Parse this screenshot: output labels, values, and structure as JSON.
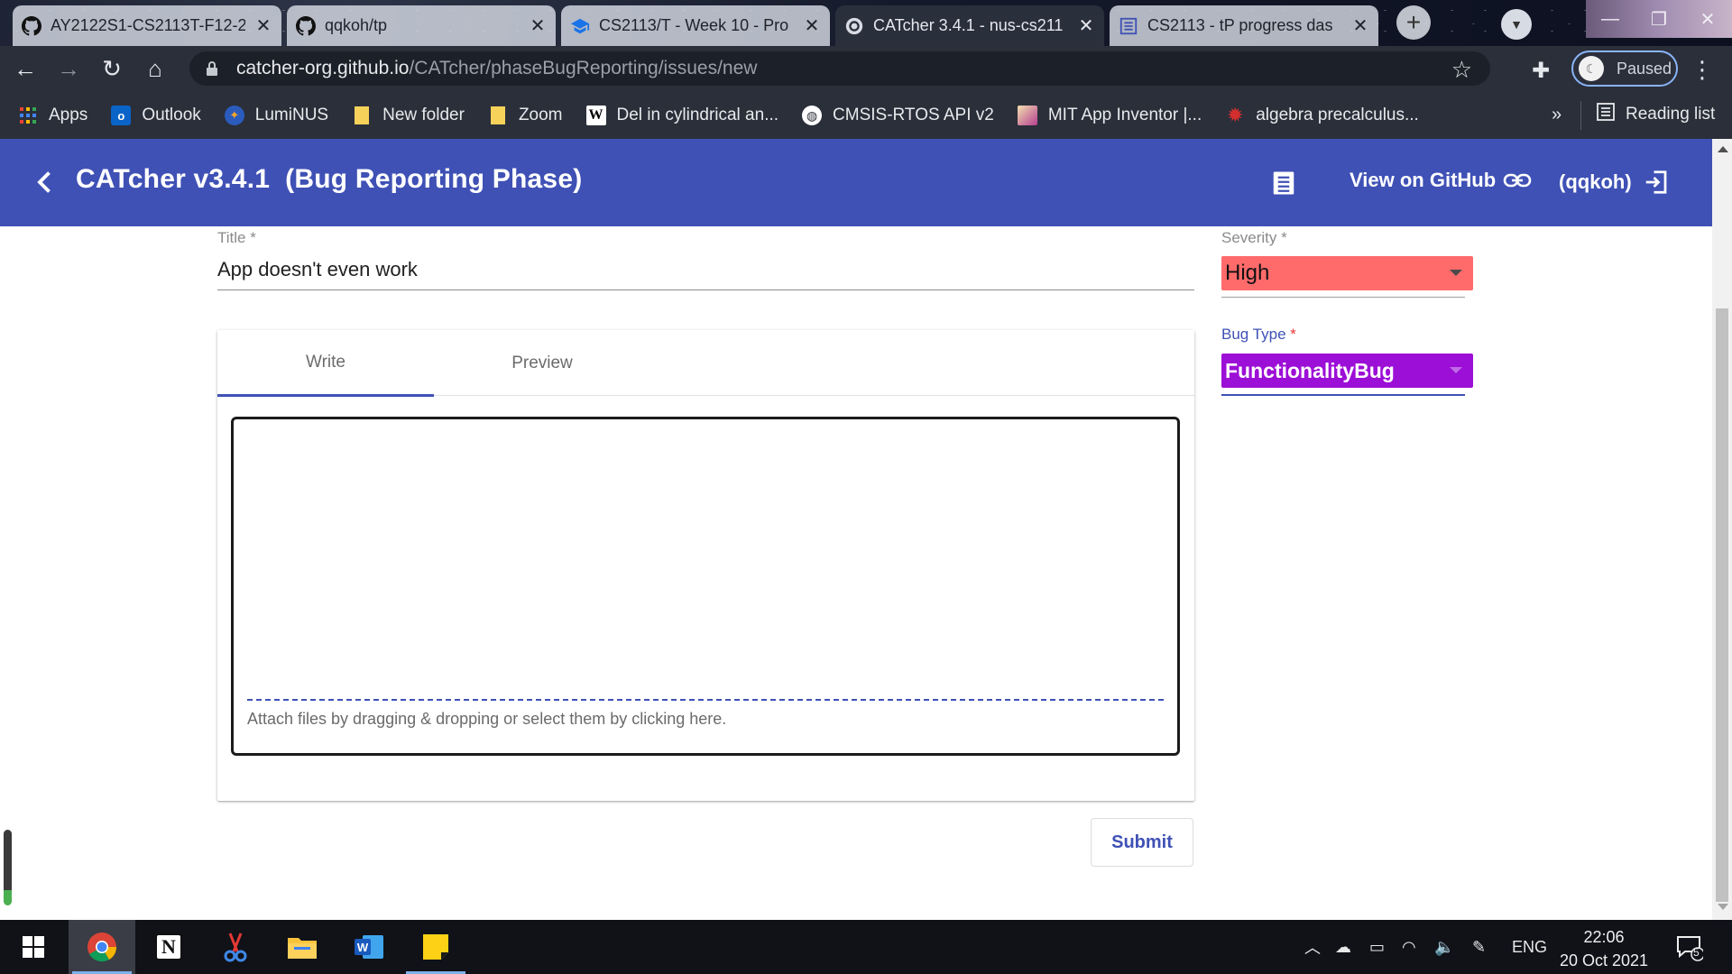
{
  "browser": {
    "tabs": [
      {
        "title": "AY2122S1-CS2113T-F12-2",
        "icon": "github-icon"
      },
      {
        "title": "qqkoh/tp",
        "icon": "github-icon"
      },
      {
        "title": "CS2113/T - Week 10 - Pro",
        "icon": "graduation-cap-icon"
      },
      {
        "title": "CATcher 3.4.1 - nus-cs211",
        "icon": "catcher-icon",
        "active": true
      },
      {
        "title": "CS2113 - tP progress das",
        "icon": "document-icon"
      }
    ],
    "url_host": "catcher-org.github.io",
    "url_path": "/CATcher/phaseBugReporting/issues/new",
    "profile_status": "Paused",
    "bookmarks": [
      {
        "label": "Apps",
        "icon": "apps-grid-icon"
      },
      {
        "label": "Outlook",
        "icon": "outlook-icon"
      },
      {
        "label": "LumiNUS",
        "icon": "luminus-icon"
      },
      {
        "label": "New folder",
        "icon": "folder-icon"
      },
      {
        "label": "Zoom",
        "icon": "folder-icon"
      },
      {
        "label": "Del in cylindrical an...",
        "icon": "wikipedia-icon"
      },
      {
        "label": "CMSIS-RTOS API v2",
        "icon": "globe-icon"
      },
      {
        "label": "MIT App Inventor |...",
        "icon": "app-inventor-icon"
      },
      {
        "label": "algebra precalculus...",
        "icon": "math-se-icon"
      }
    ],
    "more_bookmarks": "»",
    "reading_list": "Reading list"
  },
  "app": {
    "title": "CATcher v3.4.1  (Bug Reporting Phase)",
    "view_github": "View on GitHub",
    "user": "(qqkoh)",
    "accent": "#3f51b5"
  },
  "form": {
    "title_label": "Title",
    "title_value": "App doesn't even work",
    "tabs": [
      "Write",
      "Preview"
    ],
    "attach_hint": "Attach files by dragging & dropping or select them by clicking here.",
    "submit": "Submit",
    "severity_label": "Severity",
    "severity_value": "High",
    "severity_color": "#ff6b6b",
    "bugtype_label": "Bug Type",
    "bugtype_value": "FunctionalityBug",
    "bugtype_color": "#9c0fd6",
    "required_mark": "*"
  },
  "taskbar": {
    "apps": [
      "windows-start-icon",
      "chrome-icon",
      "notion-icon",
      "snipping-tool-icon",
      "file-explorer-icon",
      "word-icon",
      "sticky-notes-icon"
    ],
    "language": "ENG",
    "time": "22:06",
    "date": "20 Oct 2021",
    "notification_count": "5"
  }
}
